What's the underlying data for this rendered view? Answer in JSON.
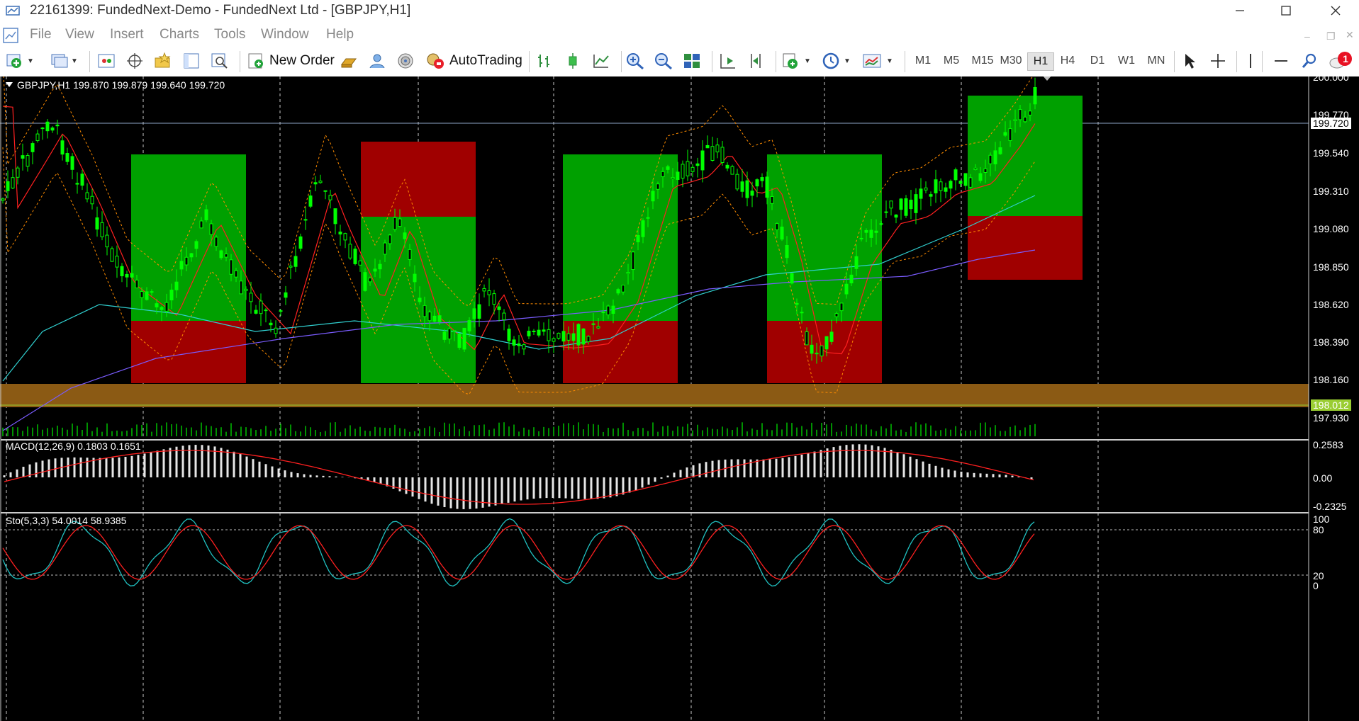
{
  "window": {
    "title": "22161399: FundedNext-Demo - FundedNext Ltd - [GBPJPY,H1]"
  },
  "menu": [
    "File",
    "View",
    "Insert",
    "Charts",
    "Tools",
    "Window",
    "Help"
  ],
  "toolbar": {
    "new_order_label": "New Order",
    "autotrading_label": "AutoTrading",
    "timeframes": [
      "M1",
      "M5",
      "M15",
      "M30",
      "H1",
      "H4",
      "D1",
      "W1",
      "MN"
    ],
    "active_timeframe": "H1",
    "notification_count": "1"
  },
  "chart": {
    "symbol_line": "GBPJPY,H1  199.870 199.879 199.640 199.720",
    "price_scale": [
      "200.000",
      "199.770",
      "199.540",
      "199.310",
      "199.080",
      "198.850",
      "198.620",
      "198.390",
      "198.160",
      "197.930"
    ],
    "current_price": "199.720",
    "marked_price": "198.012",
    "macd_label": "MACD(12,26,9) 0.1803 0.1651",
    "macd_scale": [
      "0.2583",
      "0.00",
      "-0.2325"
    ],
    "stoch_label": "Sto(5,3,3) 54.0014 58.9385",
    "stoch_scale": [
      "100",
      "80",
      "20",
      "0"
    ]
  },
  "colors": {
    "chart_background": "#000000",
    "candle_bull": "#00ff00",
    "zone_green": "#00a000",
    "zone_red": "#a00000",
    "support_band": "#8b5a14",
    "marked_price_bg": "#9acd32",
    "accent_red_badge": "#e81123"
  }
}
